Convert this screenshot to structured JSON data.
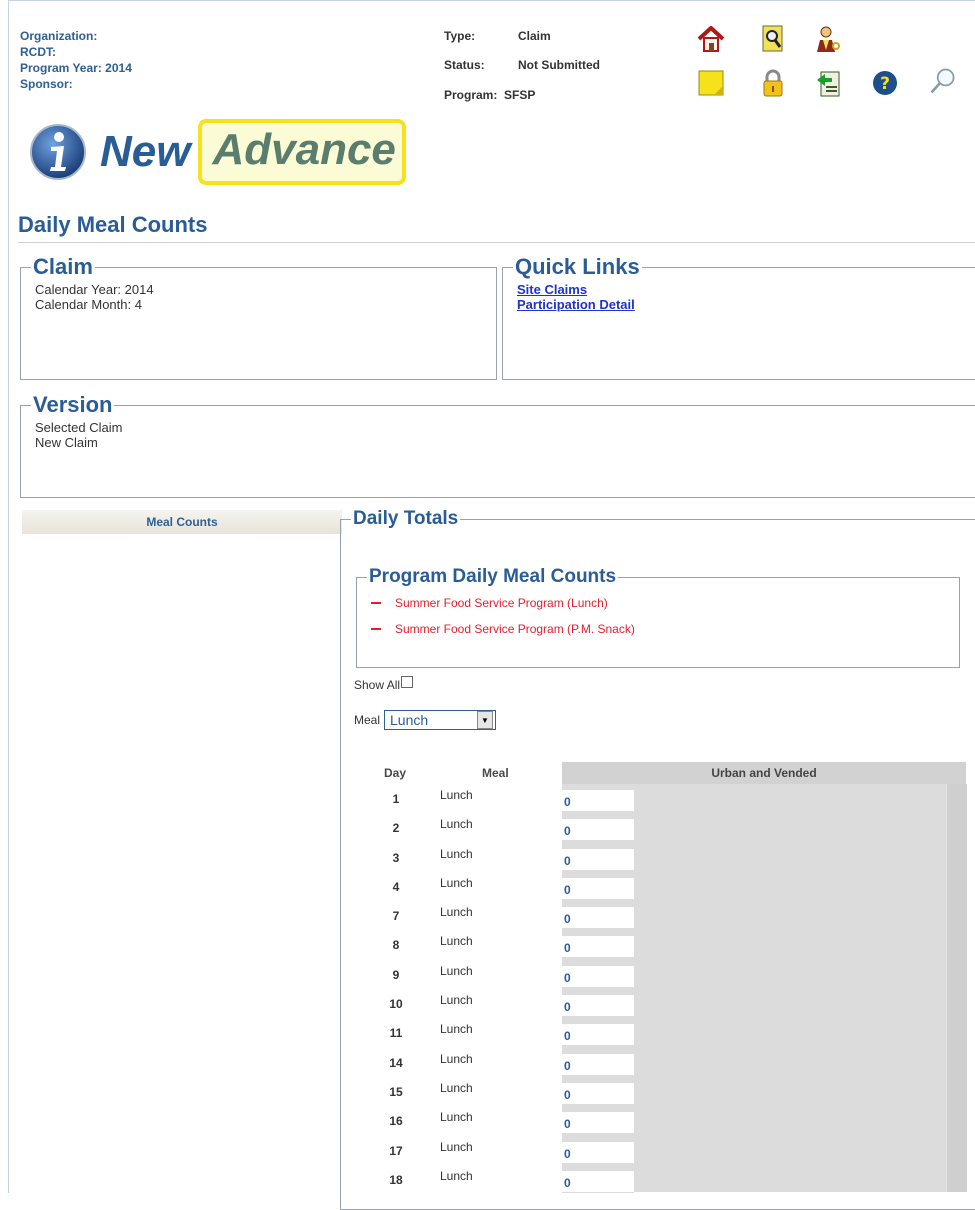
{
  "header": {
    "organization_label": "Organization:",
    "rcdt_label": "RCDT:",
    "program_year_label": "Program Year:",
    "program_year_value": "2014",
    "sponsor_label": "Sponsor:",
    "type_label": "Type:",
    "type_value": "Claim",
    "status_label": "Status:",
    "status_value": "Not Submitted",
    "program_label": "Program:",
    "program_value": "SFSP"
  },
  "toolbar": {
    "icons": [
      "home-icon",
      "search-document-icon",
      "user-key-icon",
      "note-icon",
      "lock-icon",
      "exit-icon",
      "help-icon",
      "magnifier-icon"
    ]
  },
  "brand": {
    "new": "New",
    "advance": "Advance"
  },
  "page_title": "Daily Meal Counts",
  "claim": {
    "legend": "Claim",
    "calendar_year": "Calendar Year: 2014",
    "calendar_month": "Calendar Month: 4"
  },
  "quick_links": {
    "legend": "Quick Links",
    "site_claims": "Site Claims",
    "participation_detail": "Participation Detail"
  },
  "version": {
    "legend": "Version",
    "selected_claim": "Selected Claim",
    "new_claim": "New Claim"
  },
  "sidebar": {
    "meal_counts_tab": "Meal Counts"
  },
  "daily_totals": {
    "legend": "Daily Totals",
    "program_counts_legend": "Program Daily Meal Counts",
    "programs": [
      "Summer Food Service Program (Lunch)",
      "Summer Food Service Program (P.M. Snack)"
    ],
    "show_all_label": "Show All",
    "meal_label": "Meal",
    "meal_selected": "Lunch"
  },
  "grid": {
    "col_day": "Day",
    "col_meal": "Meal",
    "col_urban": "Urban and Vended",
    "rows": [
      {
        "day": "1",
        "meal": "Lunch",
        "count": "0"
      },
      {
        "day": "2",
        "meal": "Lunch",
        "count": "0"
      },
      {
        "day": "3",
        "meal": "Lunch",
        "count": "0"
      },
      {
        "day": "4",
        "meal": "Lunch",
        "count": "0"
      },
      {
        "day": "7",
        "meal": "Lunch",
        "count": "0"
      },
      {
        "day": "8",
        "meal": "Lunch",
        "count": "0"
      },
      {
        "day": "9",
        "meal": "Lunch",
        "count": "0"
      },
      {
        "day": "10",
        "meal": "Lunch",
        "count": "0"
      },
      {
        "day": "11",
        "meal": "Lunch",
        "count": "0"
      },
      {
        "day": "14",
        "meal": "Lunch",
        "count": "0"
      },
      {
        "day": "15",
        "meal": "Lunch",
        "count": "0"
      },
      {
        "day": "16",
        "meal": "Lunch",
        "count": "0"
      },
      {
        "day": "17",
        "meal": "Lunch",
        "count": "0"
      },
      {
        "day": "18",
        "meal": "Lunch",
        "count": "0"
      }
    ]
  },
  "colors": {
    "brand_blue": "#2a5c96",
    "link_blue": "#1d33c9",
    "program_red": "#e02030",
    "highlight_yellow": "#f5e21a"
  }
}
